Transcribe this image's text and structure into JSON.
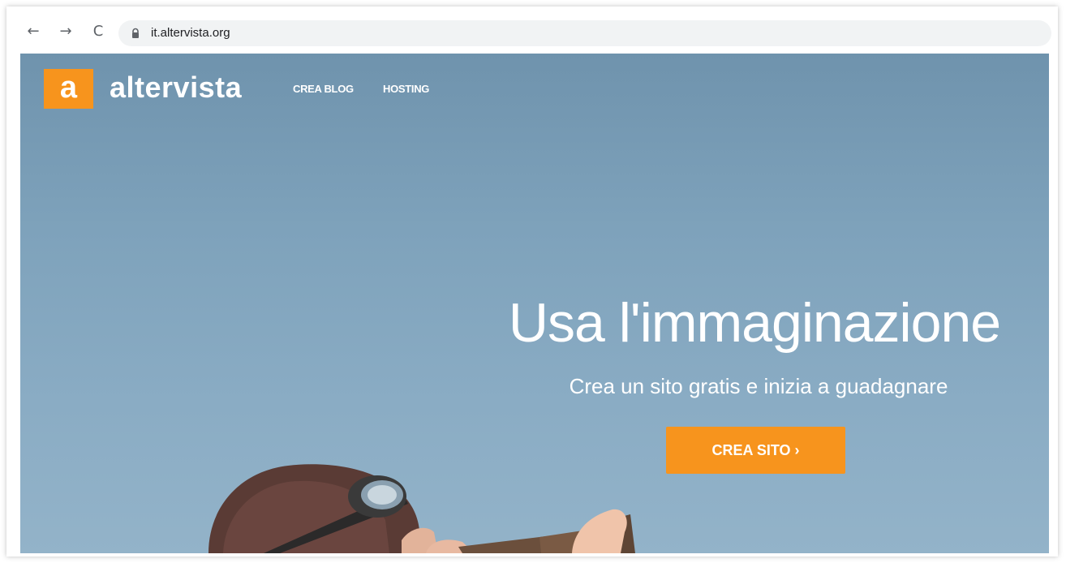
{
  "browser": {
    "url": "it.altervista.org",
    "back_glyph": "←",
    "forward_glyph": "→",
    "reload_glyph": "C"
  },
  "site": {
    "logo_letter": "a",
    "logo_name": "altervista",
    "nav": [
      {
        "label": "CREA BLOG"
      },
      {
        "label": "HOSTING"
      }
    ],
    "hero": {
      "title": "Usa l'immaginazione",
      "subtitle": "Crea un sito gratis e inizia a guadagnare",
      "cta_label": "CREA SITO ›"
    }
  },
  "colors": {
    "brand_orange": "#f7941d",
    "sky": "#7ea2bb"
  },
  "icons": [
    "back-arrow-icon",
    "forward-arrow-icon",
    "reload-icon",
    "lock-icon"
  ]
}
